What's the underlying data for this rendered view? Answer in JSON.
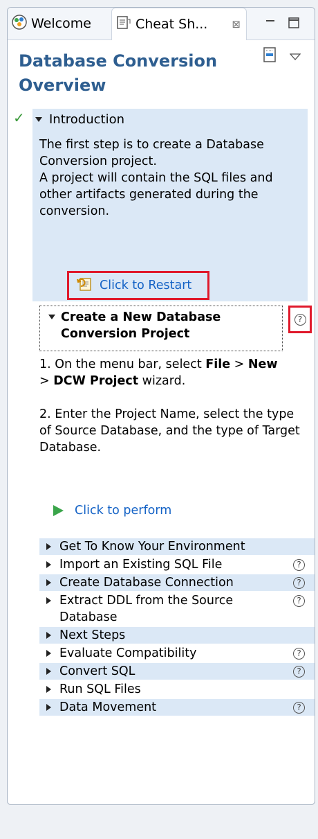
{
  "tabs": [
    {
      "label": "Welcome"
    },
    {
      "label": "Cheat Sh...",
      "close": "⊠"
    }
  ],
  "title": "Database Conversion Overview",
  "intro": {
    "heading": "Introduction",
    "text1": "The first step is to create a Database Conversion project.",
    "text2": "A project will contain the SQL files and other artifacts generated during the conversion.",
    "restart": "Click to Restart"
  },
  "step": {
    "heading": "Create a New Database Conversion Project",
    "p1_a": "1. On the menu bar, select ",
    "p1_file": "File",
    "p1_b": " > ",
    "p1_new": "New",
    "p1_c": " > ",
    "p1_dcw": "DCW Project",
    "p1_d": " wizard.",
    "p2": "2. Enter the Project Name, select the type of Source Database, and the type of Target Database.",
    "perform": "Click to perform"
  },
  "items": [
    {
      "label": "Get To Know Your Environment"
    },
    {
      "label": "Import an Existing SQL File"
    },
    {
      "label": "Create Database Connection"
    },
    {
      "label": "Extract DDL from the Source Database"
    },
    {
      "label": "Next Steps"
    },
    {
      "label": "Evaluate Compatibility"
    },
    {
      "label": "Convert SQL"
    },
    {
      "label": "Run SQL Files"
    },
    {
      "label": "Data Movement"
    }
  ],
  "colors": {
    "title": "#2e5e90",
    "link": "#1563c6",
    "highlight_box": "#e0192b",
    "section_bg": "#dbe8f6"
  }
}
